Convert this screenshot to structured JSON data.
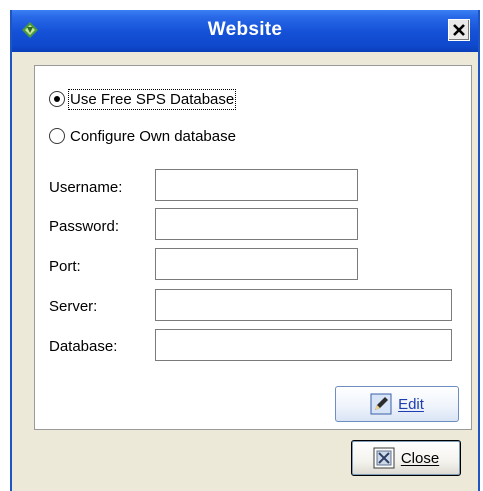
{
  "window": {
    "title": "Website",
    "app_icon": "app-logo-icon",
    "close_icon": "close-icon"
  },
  "database_mode": {
    "options": [
      {
        "label": "Use Free SPS Database",
        "selected": true
      },
      {
        "label": "Configure Own database",
        "selected": false
      }
    ]
  },
  "fields": {
    "username": {
      "label": "Username:",
      "value": ""
    },
    "password": {
      "label": "Password:",
      "value": ""
    },
    "port": {
      "label": "Port:",
      "value": ""
    },
    "server": {
      "label": "Server:",
      "value": ""
    },
    "database": {
      "label": "Database:",
      "value": ""
    }
  },
  "buttons": {
    "edit": {
      "label": "Edit",
      "icon": "pencil-icon"
    },
    "close": {
      "label": "Close",
      "icon": "close-grid-icon"
    }
  },
  "colors": {
    "titlebar": "#1552d8",
    "window_bg": "#ece9d8",
    "edit_text": "#1e3eb0"
  }
}
